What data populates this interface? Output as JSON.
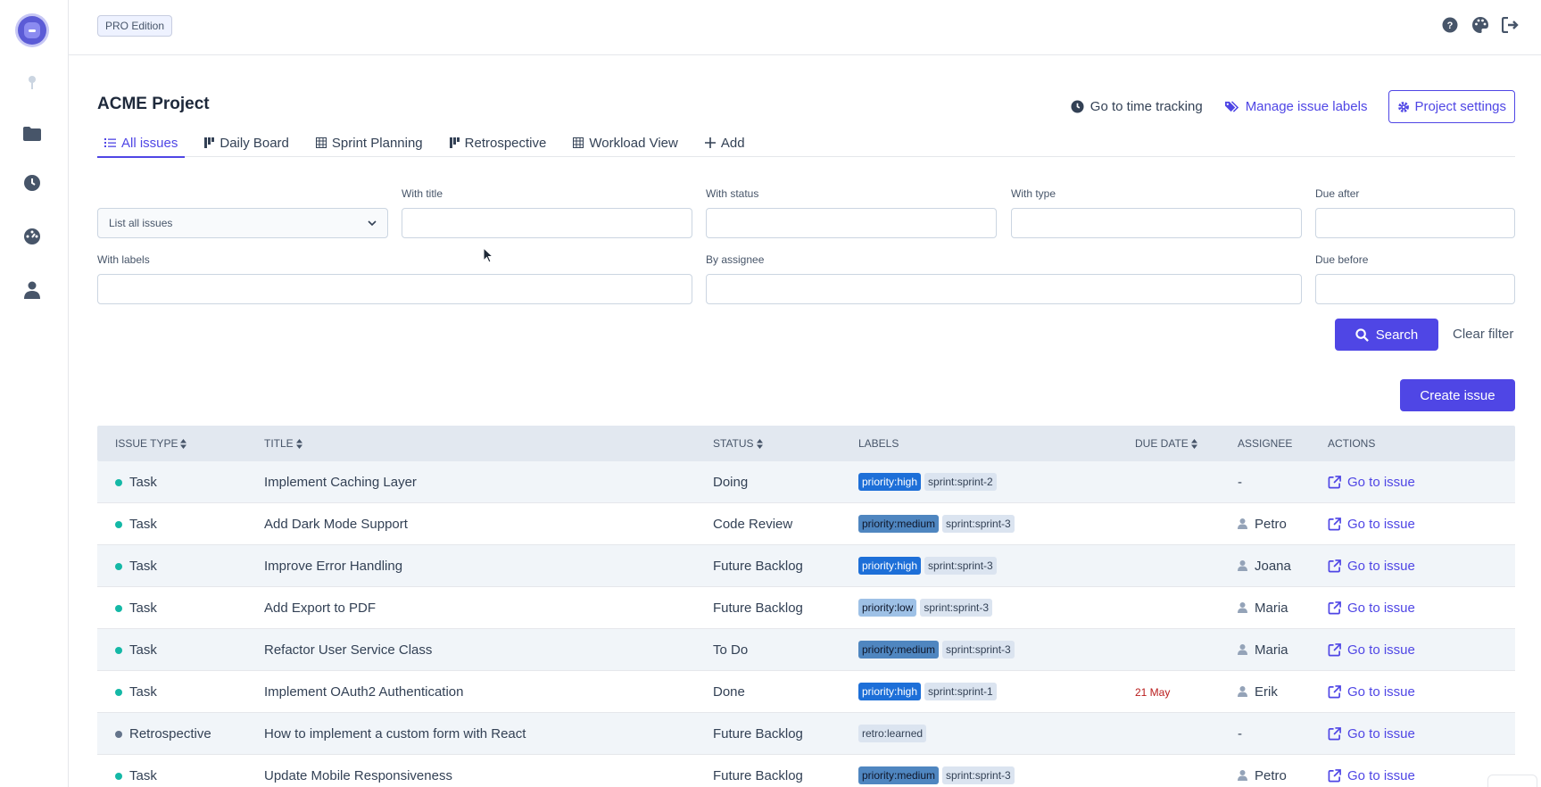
{
  "topbar": {
    "edition": "PRO Edition"
  },
  "project": {
    "title": "ACME Project",
    "time_tracking": "Go to time tracking",
    "manage_labels": "Manage issue labels",
    "settings": "Project settings"
  },
  "tabs": [
    {
      "label": "All issues",
      "icon": "list-icon"
    },
    {
      "label": "Daily Board",
      "icon": "board-icon"
    },
    {
      "label": "Sprint Planning",
      "icon": "table-icon"
    },
    {
      "label": "Retrospective",
      "icon": "board-icon"
    },
    {
      "label": "Workload View",
      "icon": "table-icon"
    },
    {
      "label": "Add",
      "icon": "plus-icon"
    }
  ],
  "filters": {
    "list_select": "List all issues",
    "with_title": "With title",
    "with_status": "With status",
    "with_type": "With type",
    "due_after": "Due after",
    "with_labels": "With labels",
    "by_assignee": "By assignee",
    "due_before": "Due before",
    "search": "Search",
    "clear": "Clear filter"
  },
  "create_issue": "Create issue",
  "table": {
    "headers": {
      "issue_type": "ISSUE TYPE",
      "title": "TITLE",
      "status": "STATUS",
      "labels": "LABELS",
      "due_date": "DUE DATE",
      "assignee": "ASSIGNEE",
      "actions": "ACTIONS"
    },
    "action_label": "Go to issue",
    "rows": [
      {
        "type": "Task",
        "title": "Implement Caching Layer",
        "status": "Doing",
        "labels": [
          {
            "text": "priority:high",
            "bg": "#1d6fd8",
            "fg": "#ffffff"
          },
          {
            "text": "sprint:sprint-2",
            "bg": "#dbe4f0",
            "fg": "#334155"
          }
        ],
        "due": "",
        "assignee": "-"
      },
      {
        "type": "Task",
        "title": "Add Dark Mode Support",
        "status": "Code Review",
        "labels": [
          {
            "text": "priority:medium",
            "bg": "#4f86c0",
            "fg": "#0f172a"
          },
          {
            "text": "sprint:sprint-3",
            "bg": "#dbe4f0",
            "fg": "#334155"
          }
        ],
        "due": "",
        "assignee": "Petro"
      },
      {
        "type": "Task",
        "title": "Improve Error Handling",
        "status": "Future Backlog",
        "labels": [
          {
            "text": "priority:high",
            "bg": "#1d6fd8",
            "fg": "#ffffff"
          },
          {
            "text": "sprint:sprint-3",
            "bg": "#dbe4f0",
            "fg": "#334155"
          }
        ],
        "due": "",
        "assignee": "Joana"
      },
      {
        "type": "Task",
        "title": "Add Export to PDF",
        "status": "Future Backlog",
        "labels": [
          {
            "text": "priority:low",
            "bg": "#9ec1e6",
            "fg": "#0f172a"
          },
          {
            "text": "sprint:sprint-3",
            "bg": "#dbe4f0",
            "fg": "#334155"
          }
        ],
        "due": "",
        "assignee": "Maria"
      },
      {
        "type": "Task",
        "title": "Refactor User Service Class",
        "status": "To Do",
        "labels": [
          {
            "text": "priority:medium",
            "bg": "#4f86c0",
            "fg": "#0f172a"
          },
          {
            "text": "sprint:sprint-3",
            "bg": "#dbe4f0",
            "fg": "#334155"
          }
        ],
        "due": "",
        "assignee": "Maria"
      },
      {
        "type": "Task",
        "title": "Implement OAuth2 Authentication",
        "status": "Done",
        "labels": [
          {
            "text": "priority:high",
            "bg": "#1d6fd8",
            "fg": "#ffffff"
          },
          {
            "text": "sprint:sprint-1",
            "bg": "#dbe4f0",
            "fg": "#334155"
          }
        ],
        "due": "21 May",
        "assignee": "Erik"
      },
      {
        "type": "Retrospective",
        "title": "How to implement a custom form with React",
        "status": "Future Backlog",
        "labels": [
          {
            "text": "retro:learned",
            "bg": "#dbe4f0",
            "fg": "#334155"
          }
        ],
        "due": "",
        "assignee": "-"
      },
      {
        "type": "Task",
        "title": "Update Mobile Responsiveness",
        "status": "Future Backlog",
        "labels": [
          {
            "text": "priority:medium",
            "bg": "#4f86c0",
            "fg": "#0f172a"
          },
          {
            "text": "sprint:sprint-3",
            "bg": "#dbe4f0",
            "fg": "#334155"
          }
        ],
        "due": "",
        "assignee": "Petro"
      }
    ]
  },
  "colors": {
    "accent": "#4f46e5",
    "task_dot": "#14b8a6",
    "retro_dot": "#64748b",
    "due_red": "#b91c1c"
  }
}
